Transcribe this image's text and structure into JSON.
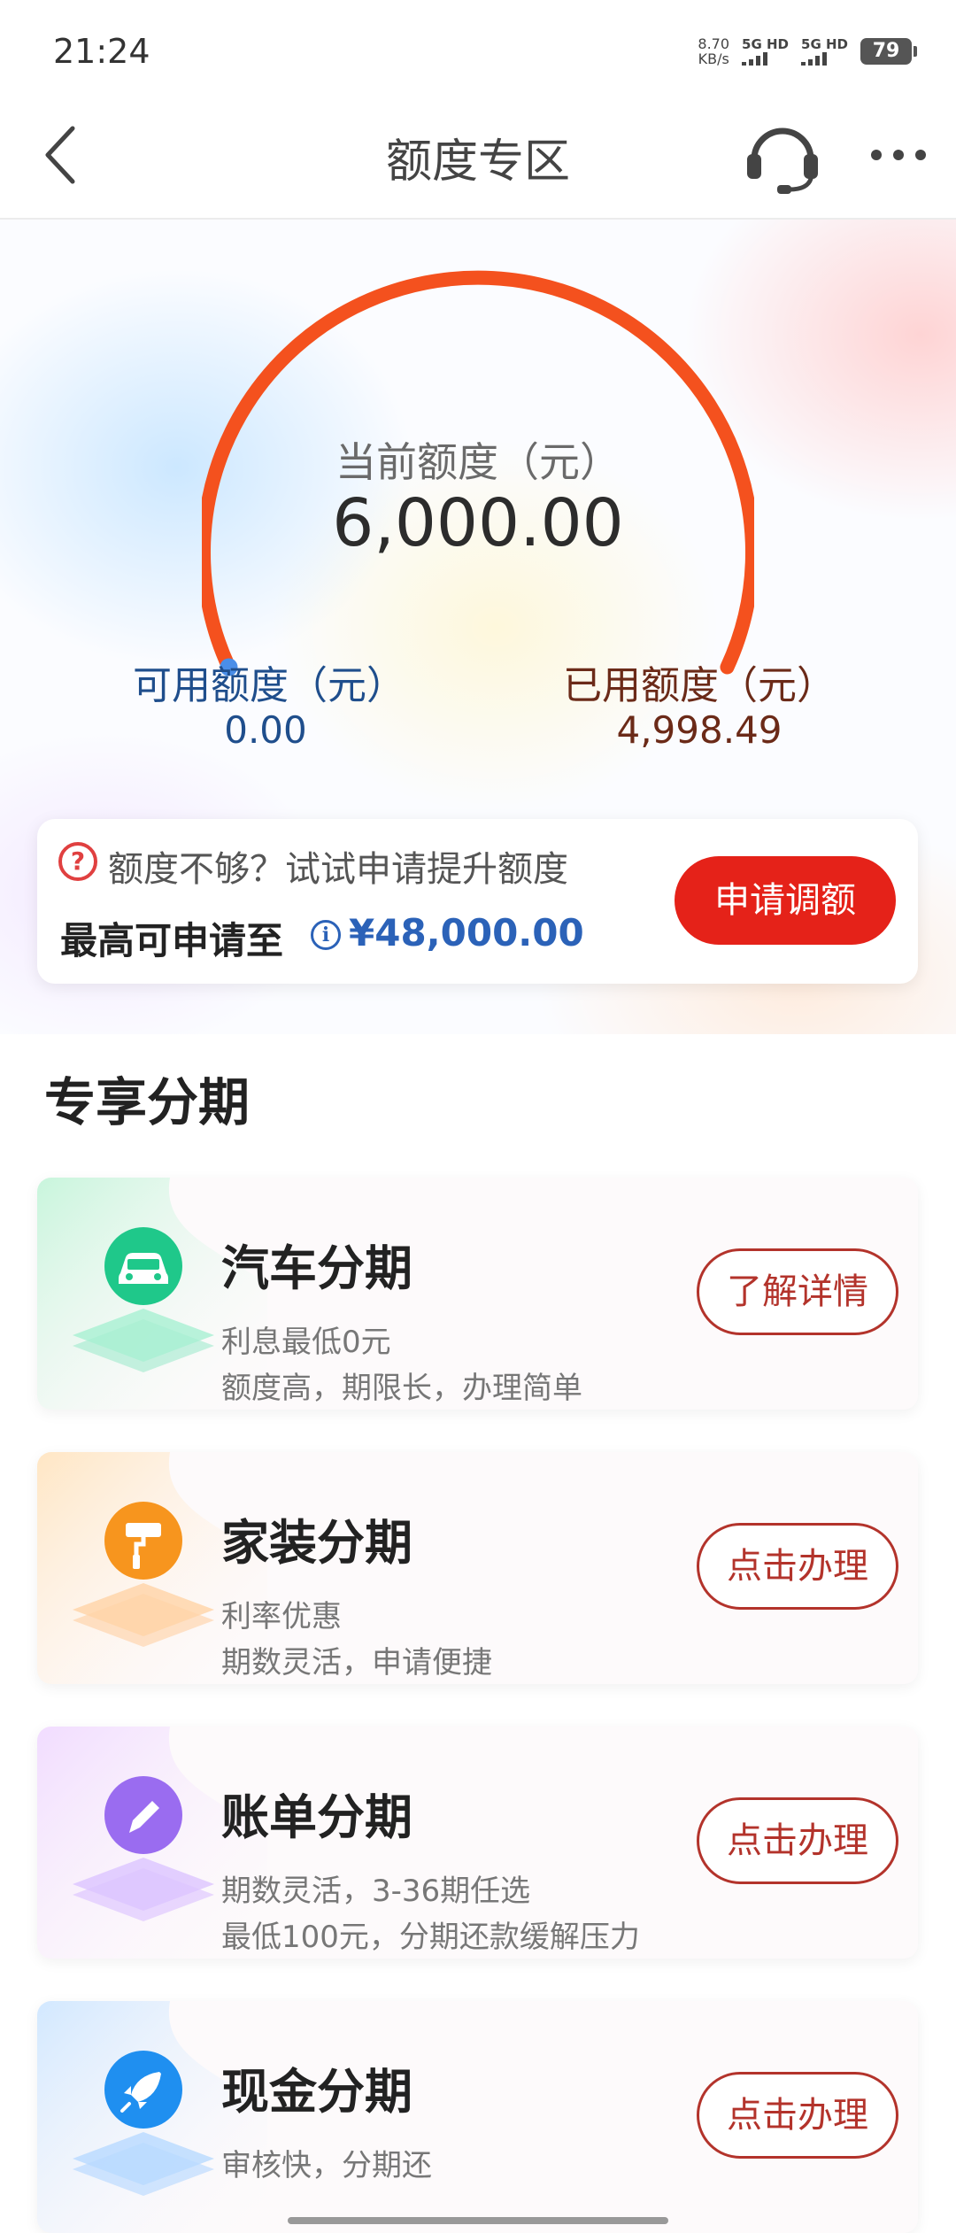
{
  "status_bar": {
    "time": "21:24",
    "net_speed_value": "8.70",
    "net_speed_unit": "KB/s",
    "signal1_label": "5G HD",
    "signal2_label": "5G HD",
    "battery": "79"
  },
  "nav": {
    "title": "额度专区",
    "icons": [
      "back-arrow-icon",
      "customer-service-headset-icon",
      "more-dots-icon"
    ]
  },
  "credit": {
    "current_label": "当前额度（元）",
    "current_value": "6,000.00",
    "available_label": "可用额度（元）",
    "available_value": "0.00",
    "used_label": "已用额度（元）",
    "used_value": "4,998.49",
    "gauge_accent": "#f4511e"
  },
  "promo": {
    "question": "额度不够？试试申请提升额度",
    "max_label": "最高可申请至",
    "max_amount": "¥48,000.00",
    "apply_button": "申请调额",
    "button_color": "#e52219"
  },
  "section": {
    "title": "专享分期"
  },
  "cards": [
    {
      "title": "汽车分期",
      "desc1": "利息最低0元",
      "desc2": "额度高，期限长，办理简单",
      "button": "了解详情",
      "icon": "car-icon",
      "color": "#1fc88a"
    },
    {
      "title": "家装分期",
      "desc1": "利率优惠",
      "desc2": "期数灵活，申请便捷",
      "button": "点击办理",
      "icon": "paint-roller-icon",
      "color": "#f7951e"
    },
    {
      "title": "账单分期",
      "desc1": "期数灵活，3-36期任选",
      "desc2": "最低100元，分期还款缓解压力",
      "button": "点击办理",
      "icon": "pencil-icon",
      "color": "#9a6cf0"
    },
    {
      "title": "现金分期",
      "desc1": "审核快，分期还",
      "desc2": "",
      "button": "点击办理",
      "icon": "rocket-icon",
      "color": "#1f8ff0"
    }
  ]
}
